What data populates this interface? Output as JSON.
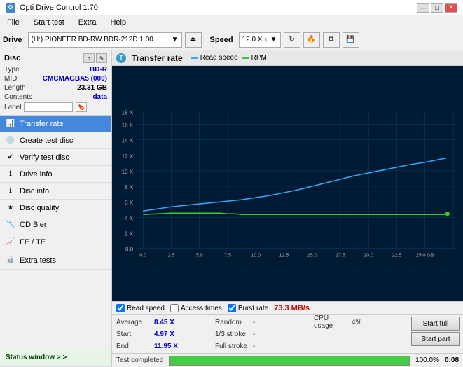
{
  "app": {
    "title": "Opti Drive Control 1.70",
    "title_icon": "O"
  },
  "titlebar": {
    "minimize": "—",
    "maximize": "□",
    "close": "✕"
  },
  "menubar": {
    "items": [
      "File",
      "Start test",
      "Extra",
      "Help"
    ]
  },
  "toolbar": {
    "drive_label": "Drive",
    "drive_value": "(H:)  PIONEER BD-RW  BDR-212D 1.00",
    "speed_label": "Speed",
    "speed_value": "12.0 X ↓"
  },
  "disc": {
    "section_label": "Disc",
    "type_label": "Type",
    "type_value": "BD-R",
    "mid_label": "MID",
    "mid_value": "CMCMAGBA5 (000)",
    "length_label": "Length",
    "length_value": "23.31 GB",
    "contents_label": "Contents",
    "contents_value": "data",
    "label_label": "Label",
    "label_value": ""
  },
  "nav": {
    "items": [
      {
        "id": "transfer-rate",
        "label": "Transfer rate",
        "active": true
      },
      {
        "id": "create-test-disc",
        "label": "Create test disc",
        "active": false
      },
      {
        "id": "verify-test-disc",
        "label": "Verify test disc",
        "active": false
      },
      {
        "id": "drive-info",
        "label": "Drive info",
        "active": false
      },
      {
        "id": "disc-info",
        "label": "Disc info",
        "active": false
      },
      {
        "id": "disc-quality",
        "label": "Disc quality",
        "active": false
      },
      {
        "id": "cd-bler",
        "label": "CD Bler",
        "active": false
      }
    ],
    "bottom_items": [
      {
        "id": "fe-te",
        "label": "FE / TE"
      },
      {
        "id": "extra-tests",
        "label": "Extra tests"
      }
    ],
    "status_window": "Status window > >"
  },
  "chart": {
    "title": "Transfer rate",
    "icon": "T",
    "legend": {
      "read_speed": "Read speed",
      "rpm": "RPM"
    },
    "y_labels": [
      "18 X",
      "16 X",
      "14 X",
      "12 X",
      "10 X",
      "8 X",
      "6 X",
      "4 X",
      "2 X",
      "0.0"
    ],
    "x_labels": [
      "0.0",
      "2.5",
      "5.0",
      "7.5",
      "10.0",
      "12.5",
      "15.0",
      "17.5",
      "20.0",
      "22.5",
      "25.0 GB"
    ]
  },
  "controls": {
    "read_speed_checked": true,
    "read_speed_label": "Read speed",
    "access_times_checked": false,
    "access_times_label": "Access times",
    "burst_rate_checked": true,
    "burst_rate_label": "Burst rate",
    "burst_value": "73.3 MB/s"
  },
  "stats": {
    "average_label": "Average",
    "average_value": "8.45 X",
    "random_label": "Random",
    "random_value": "-",
    "cpu_label": "CPU usage",
    "cpu_value": "4%",
    "start_label": "Start",
    "start_value": "4.97 X",
    "stroke1_label": "1/3 stroke",
    "stroke1_value": "-",
    "end_label": "End",
    "end_value": "11.95 X",
    "full_stroke_label": "Full stroke",
    "full_stroke_value": "-"
  },
  "buttons": {
    "start_full": "Start full",
    "start_part": "Start part"
  },
  "progress": {
    "percent": 100,
    "status": "Test completed",
    "time": "0:08"
  }
}
